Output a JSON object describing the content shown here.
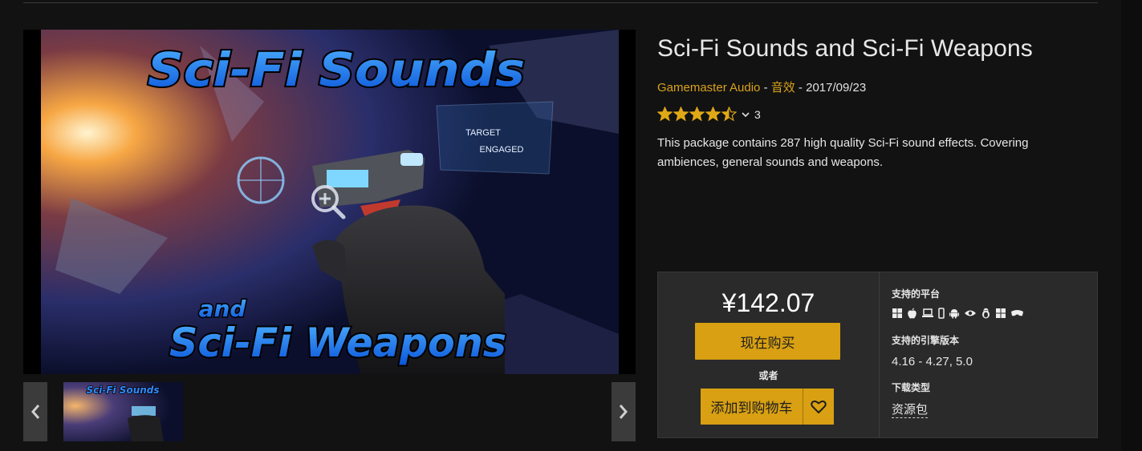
{
  "product": {
    "title": "Sci-Fi Sounds and Sci-Fi Weapons",
    "publisher": "Gamemaster Audio",
    "meta_separator_1": " - ",
    "category": "音效",
    "meta_separator_2": " - ",
    "release_date": "2017/09/23",
    "rating_stars": 4.5,
    "rating_max": 5,
    "rating_count": "3",
    "description": "This package contains 287 high quality Sci-Fi sound effects. Covering ambiences, general sounds and weapons."
  },
  "hero": {
    "line_1": "Sci-Fi Sounds",
    "line_2": "and",
    "line_3": "Sci-Fi Weapons",
    "hud_line_1": "TARGET",
    "hud_line_2": "ENGAGED"
  },
  "gallery": {
    "thumb_caption": "Sci-Fi Sounds",
    "prev_icon": "chevron-left-icon",
    "next_icon": "chevron-right-icon"
  },
  "purchase": {
    "price": "¥142.07",
    "buy_now_label": "现在购买",
    "or_label": "或者",
    "add_to_cart_label": "添加到购物车",
    "wishlist_icon": "heart-icon"
  },
  "specs": {
    "platforms_label": "支持的平台",
    "platform_icons": [
      "windows-icon",
      "apple-icon",
      "laptop-icon",
      "mobile-icon",
      "android-icon",
      "eye-icon",
      "linux-icon",
      "windows-icon",
      "headset-icon"
    ],
    "engine_label": "支持的引擎版本",
    "engine_versions": "4.16 - 4.27, 5.0",
    "download_label": "下载类型",
    "download_type": "资源包"
  },
  "colors": {
    "accent": "#d8a012",
    "link": "#d9a21b",
    "background": "#121212",
    "panel": "#2a2a2a",
    "star": "#e0a817"
  }
}
